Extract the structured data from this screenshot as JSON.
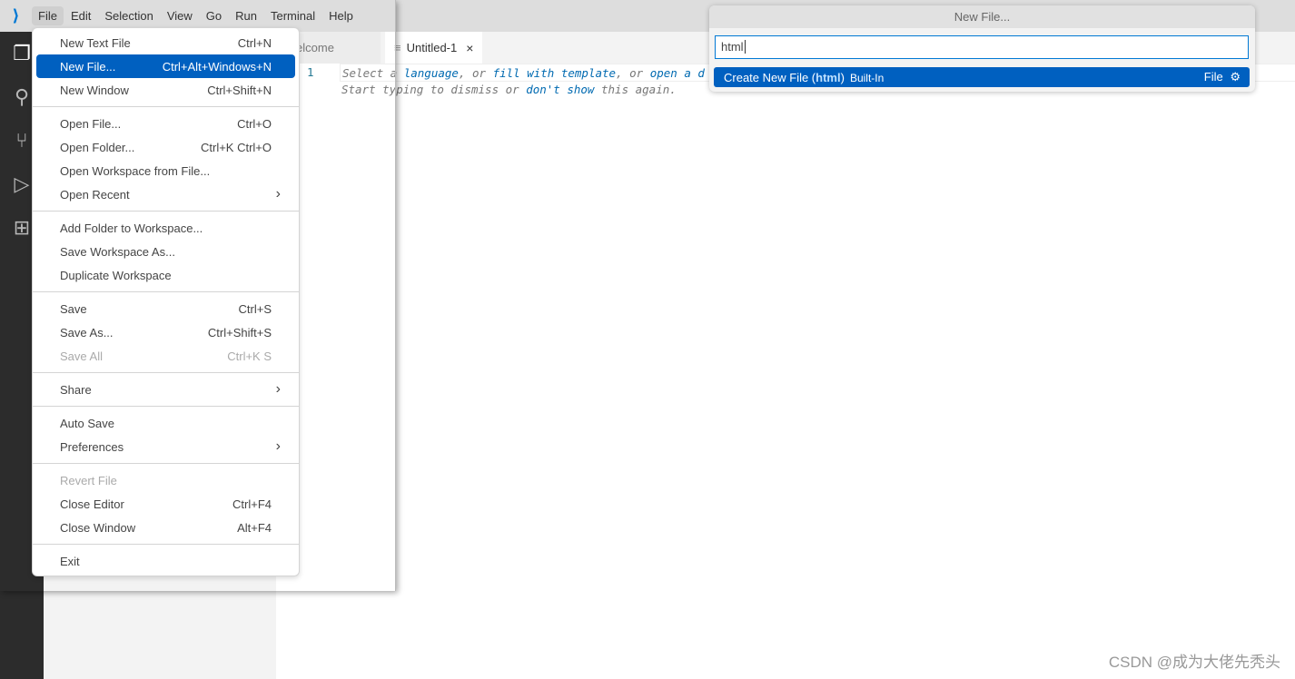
{
  "titlebar": {
    "menus": [
      "File",
      "Edit",
      "Selection",
      "View",
      "Go",
      "Run",
      "Terminal",
      "Help"
    ]
  },
  "tabs": [
    {
      "label": "Welcome"
    },
    {
      "label": "Untitled-1",
      "close": "×"
    }
  ],
  "editor": {
    "line_number": "1",
    "hint_line1_parts": [
      "Select a ",
      "language",
      ", or ",
      "fill with template",
      ", or ",
      "open a d"
    ],
    "hint_line2_parts": [
      "Start typing to dismiss or ",
      "don't show",
      " this again."
    ]
  },
  "file_menu": {
    "items": [
      {
        "label": "New Text File",
        "shortcut": "Ctrl+N"
      },
      {
        "label": "New File...",
        "shortcut": "Ctrl+Alt+Windows+N",
        "selected": true
      },
      {
        "label": "New Window",
        "shortcut": "Ctrl+Shift+N"
      },
      {
        "label": "Open File...",
        "shortcut": "Ctrl+O"
      },
      {
        "label": "Open Folder...",
        "shortcut": "Ctrl+K Ctrl+O"
      },
      {
        "label": "Open Workspace from File...",
        "shortcut": ""
      },
      {
        "label": "Open Recent",
        "shortcut": "›"
      },
      {
        "label": "Add Folder to Workspace...",
        "shortcut": ""
      },
      {
        "label": "Save Workspace As...",
        "shortcut": ""
      },
      {
        "label": "Duplicate Workspace",
        "shortcut": ""
      },
      {
        "label": "Save",
        "shortcut": "Ctrl+S"
      },
      {
        "label": "Save As...",
        "shortcut": "Ctrl+Shift+S"
      },
      {
        "label": "Save All",
        "shortcut": "Ctrl+K S",
        "disabled": true
      },
      {
        "label": "Share",
        "shortcut": "›"
      },
      {
        "label": "Auto Save",
        "shortcut": ""
      },
      {
        "label": "Preferences",
        "shortcut": "›"
      },
      {
        "label": "Revert File",
        "shortcut": "",
        "disabled": true
      },
      {
        "label": "Close Editor",
        "shortcut": "Ctrl+F4"
      },
      {
        "label": "Close Window",
        "shortcut": "Alt+F4"
      },
      {
        "label": "Exit",
        "shortcut": ""
      }
    ],
    "separators_after": [
      2,
      6,
      9,
      12,
      13,
      15,
      18
    ]
  },
  "quick_pick": {
    "title": "New File...",
    "input_value": "html",
    "result": {
      "prefix": "Create New File (",
      "highlight": "html",
      "suffix": ")",
      "source": "Built-In",
      "category": "File"
    }
  },
  "watermark": "CSDN @成为大佬先秃头",
  "colors": {
    "accent": "#0060c0",
    "activity_bar": "#2c2c2c"
  }
}
